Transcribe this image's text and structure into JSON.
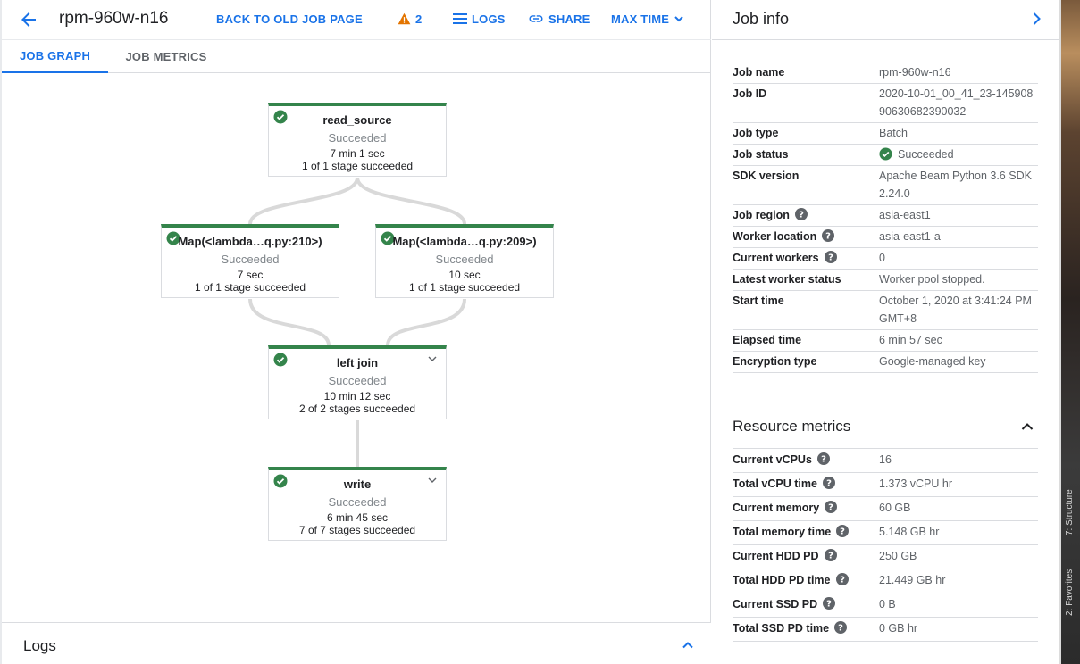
{
  "header": {
    "job_title": "rpm-960w-n16",
    "back_to_old": "BACK TO OLD JOB PAGE",
    "warning_count": "2",
    "logs": "LOGS",
    "share": "SHARE",
    "max_time": "MAX TIME"
  },
  "tabs": [
    {
      "label": "JOB GRAPH",
      "active": true
    },
    {
      "label": "JOB METRICS",
      "active": false
    }
  ],
  "graph": {
    "nodes": [
      {
        "name": "read_source",
        "status": "Succeeded",
        "time": "7 min 1 sec",
        "stages": "1 of 1 stage succeeded"
      },
      {
        "name": "Map(<lambda…q.py:210>)",
        "status": "Succeeded",
        "time": "7 sec",
        "stages": "1 of 1 stage succeeded"
      },
      {
        "name": "Map(<lambda…q.py:209>)",
        "status": "Succeeded",
        "time": "10 sec",
        "stages": "1 of 1 stage succeeded"
      },
      {
        "name": "left join",
        "status": "Succeeded",
        "time": "10 min 12 sec",
        "stages": "2 of 2 stages succeeded"
      },
      {
        "name": "write",
        "status": "Succeeded",
        "time": "6 min 45 sec",
        "stages": "7 of 7 stages succeeded"
      }
    ]
  },
  "logs_panel": {
    "title": "Logs"
  },
  "job_info": {
    "title": "Job info",
    "rows": [
      {
        "key": "Job name",
        "value": "rpm-960w-n16"
      },
      {
        "key": "Job ID",
        "value": "2020-10-01_00_41_23-14590890630682390032"
      },
      {
        "key": "Job type",
        "value": "Batch"
      },
      {
        "key": "Job status",
        "value": "Succeeded"
      },
      {
        "key": "SDK version",
        "value": "Apache Beam Python 3.6 SDK 2.24.0"
      },
      {
        "key": "Job region",
        "value": "asia-east1"
      },
      {
        "key": "Worker location",
        "value": "asia-east1-a"
      },
      {
        "key": "Current workers",
        "value": "0"
      },
      {
        "key": "Latest worker status",
        "value": "Worker pool stopped."
      },
      {
        "key": "Start time",
        "value": "October 1, 2020 at 3:41:24 PM GMT+8"
      },
      {
        "key": "Elapsed time",
        "value": "6 min 57 sec"
      },
      {
        "key": "Encryption type",
        "value": "Google-managed key"
      }
    ]
  },
  "resource_metrics": {
    "title": "Resource metrics",
    "rows": [
      {
        "key": "Current vCPUs",
        "value": "16"
      },
      {
        "key": "Total vCPU time",
        "value": "1.373 vCPU hr"
      },
      {
        "key": "Current memory",
        "value": "60 GB"
      },
      {
        "key": "Total memory time",
        "value": "5.148 GB hr"
      },
      {
        "key": "Current HDD PD",
        "value": "250 GB"
      },
      {
        "key": "Total HDD PD time",
        "value": "21.449 GB hr"
      },
      {
        "key": "Current SSD PD",
        "value": "0 B"
      },
      {
        "key": "Total SSD PD time",
        "value": "0 GB hr"
      }
    ]
  },
  "desktop_strip": {
    "structure": "7: Structure",
    "favorites": "2: Favorites"
  },
  "colors": {
    "accent": "#1a73e8",
    "success": "#34844b",
    "warning": "#e37400"
  }
}
